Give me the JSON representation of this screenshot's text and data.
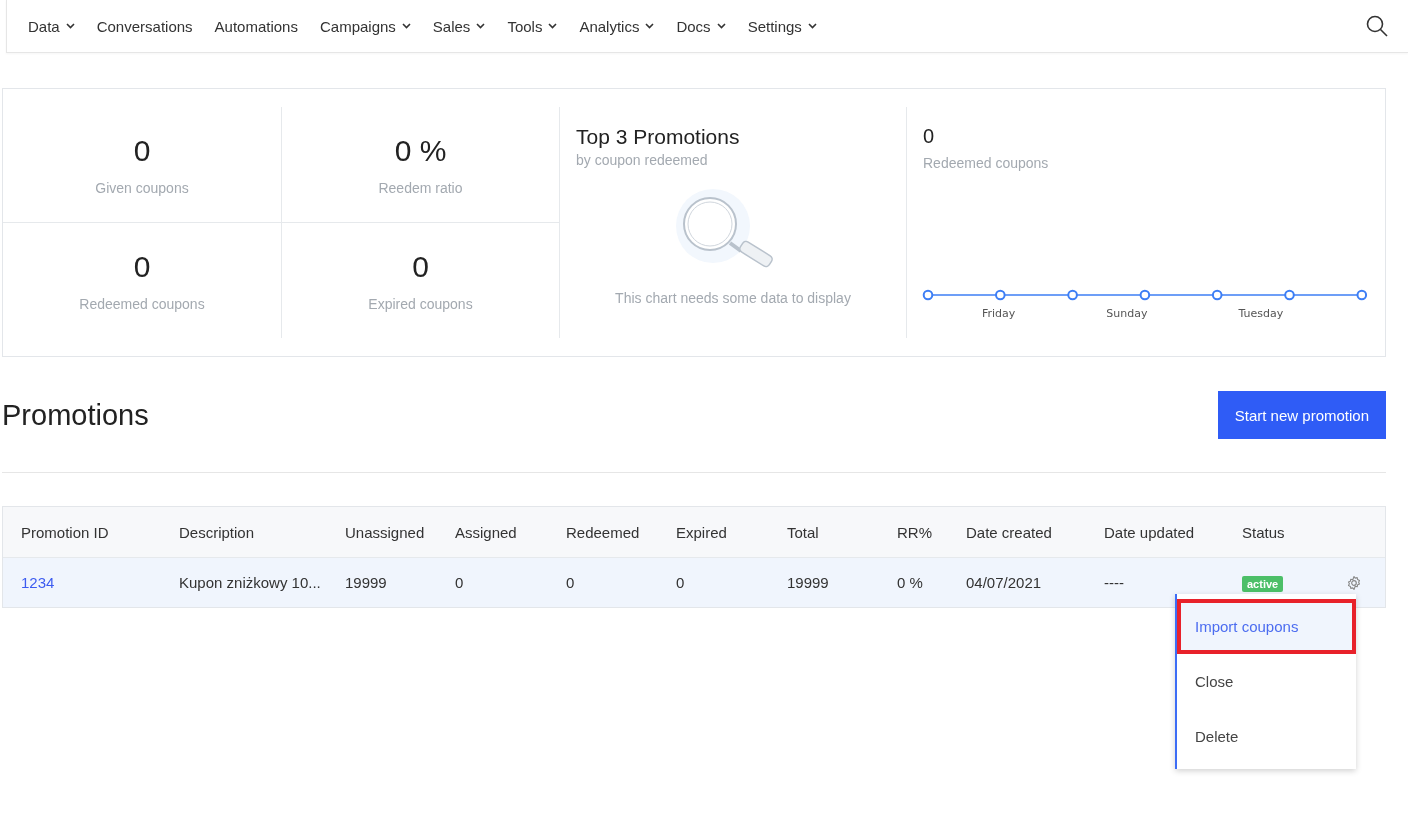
{
  "nav": {
    "items": [
      {
        "label": "Data",
        "dropdown": true
      },
      {
        "label": "Conversations",
        "dropdown": false
      },
      {
        "label": "Automations",
        "dropdown": false
      },
      {
        "label": "Campaigns",
        "dropdown": true
      },
      {
        "label": "Sales",
        "dropdown": true
      },
      {
        "label": "Tools",
        "dropdown": true
      },
      {
        "label": "Analytics",
        "dropdown": true
      },
      {
        "label": "Docs",
        "dropdown": true
      },
      {
        "label": "Settings",
        "dropdown": true
      }
    ]
  },
  "stats": [
    {
      "value": "0",
      "label": "Given coupons"
    },
    {
      "value": "0 %",
      "label": "Reedem ratio"
    },
    {
      "value": "0",
      "label": "Redeemed coupons"
    },
    {
      "value": "0",
      "label": "Expired coupons"
    }
  ],
  "top_promotions": {
    "title": "Top 3 Promotions",
    "subtitle": "by coupon redeemed",
    "empty_message": "This chart needs some data to display"
  },
  "redeemed_chart": {
    "value": "0",
    "label": "Redeemed coupons",
    "x_labels": [
      "Friday",
      "Sunday",
      "Tuesday"
    ]
  },
  "promotions": {
    "title": "Promotions",
    "button": "Start new promotion"
  },
  "table": {
    "columns": [
      "Promotion ID",
      "Description",
      "Unassigned",
      "Assigned",
      "Redeemed",
      "Expired",
      "Total",
      "RR%",
      "Date created",
      "Date updated",
      "Status"
    ],
    "rows": [
      {
        "cells": [
          "1234",
          "Kupon zniżkowy 10...",
          "19999",
          "0",
          "0",
          "0",
          "19999",
          "0 %",
          "04/07/2021",
          "----"
        ],
        "status": "active"
      }
    ]
  },
  "row_menu": {
    "items": [
      {
        "label": "Import coupons",
        "selected": true,
        "annotated": true
      },
      {
        "label": "Close",
        "selected": false,
        "annotated": false
      },
      {
        "label": "Delete",
        "selected": false,
        "annotated": false
      }
    ]
  }
}
